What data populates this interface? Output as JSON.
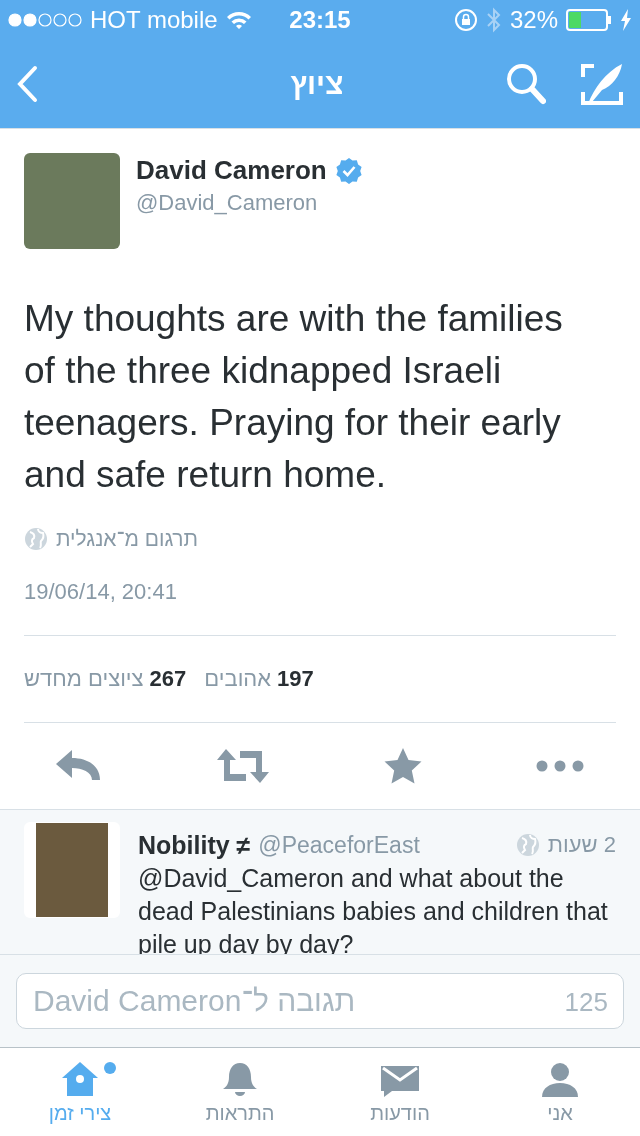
{
  "status_bar": {
    "carrier": "HOT mobile",
    "time": "23:15",
    "battery": "32%"
  },
  "nav": {
    "title": "ציוץ"
  },
  "tweet": {
    "name": "David Cameron",
    "verified": true,
    "handle": "@David_Cameron",
    "text": "My thoughts are with the families of the three kidnapped Israeli teenagers. Praying for their early and safe return home.",
    "translate": "תרגום מ־אנגלית",
    "timestamp": "19/06/14, 20:41",
    "stats": [
      {
        "count": "197",
        "label": "אהובים"
      },
      {
        "count": "267",
        "label": "ציוצים מחדש"
      }
    ]
  },
  "reply_tweet": {
    "name": "Nobility ≠",
    "handle": "@PeaceforEast",
    "time": "2 שעות",
    "text": "@David_Cameron and what about the dead Palestinians babies and children that pile up day by day?"
  },
  "reply_box": {
    "placeholder": "תגובה ל־David Cameron",
    "counter": "125"
  },
  "tabs": [
    {
      "kind": "person",
      "label": "אני",
      "selected": false,
      "unread": false
    },
    {
      "kind": "mail",
      "label": "הודעות",
      "selected": false,
      "unread": false
    },
    {
      "kind": "bell",
      "label": "התראות",
      "selected": false,
      "unread": false
    },
    {
      "kind": "home",
      "label": "צירי זמן",
      "selected": true,
      "unread": true
    }
  ]
}
